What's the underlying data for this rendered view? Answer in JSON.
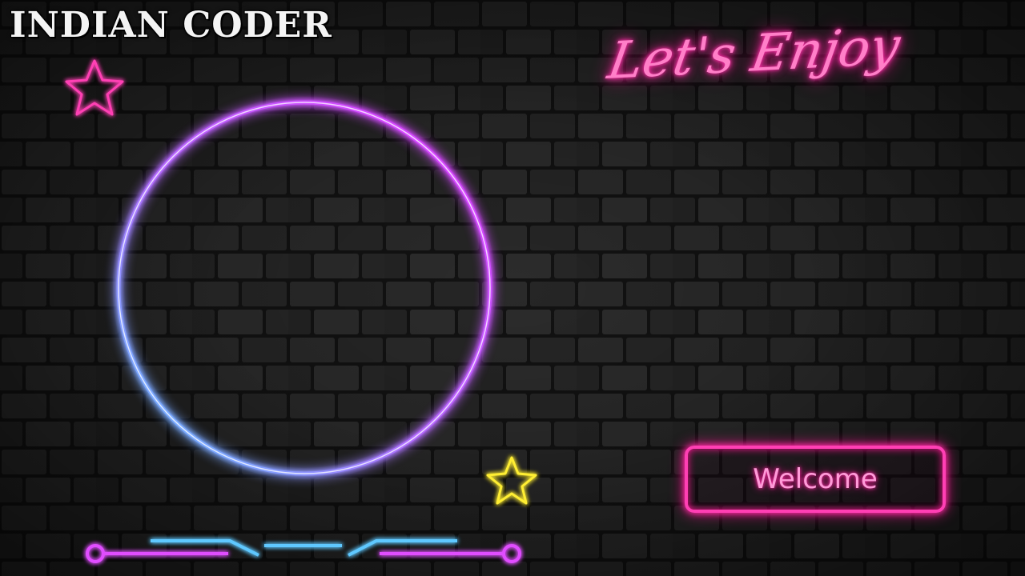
{
  "brand": {
    "title": "INDIAN CODER"
  },
  "headline": {
    "text": "Let's Enjoy"
  },
  "cta": {
    "label": "Welcome"
  },
  "decor": {
    "star_top_icon": "star-outline-icon",
    "star_bottom_icon": "star-outline-icon",
    "ring_icon": "neon-ring"
  },
  "colors": {
    "background": "#232323",
    "neon_pink": "#ff3fb4",
    "neon_magenta": "#d04bff",
    "neon_blue": "#5ec8ff",
    "neon_yellow": "#ffee33",
    "text_white": "#f4f4f4"
  }
}
